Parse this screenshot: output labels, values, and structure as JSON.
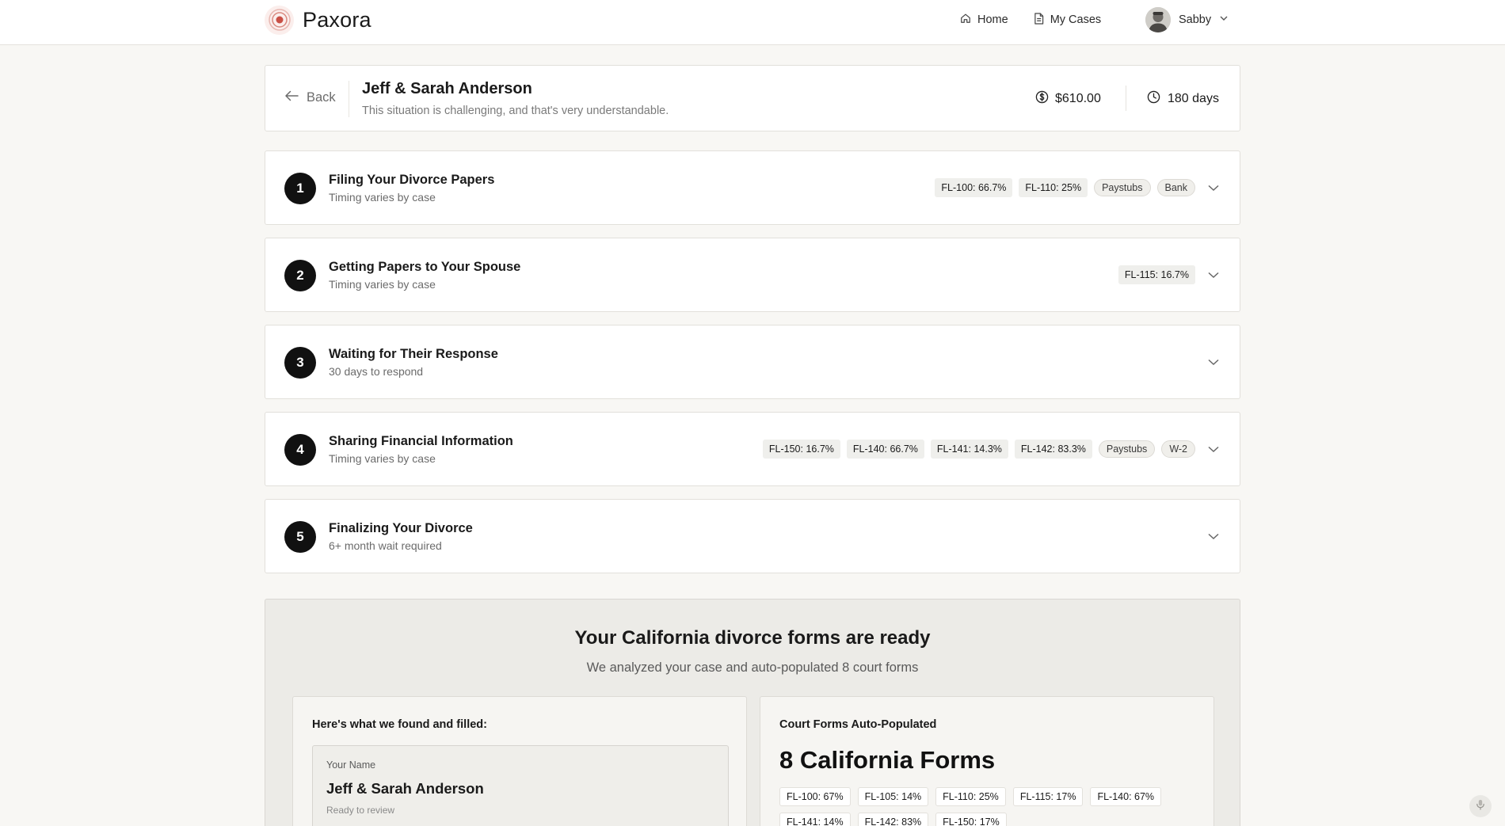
{
  "app": {
    "brand_name": "Paxora",
    "accent_color": "#c94f45"
  },
  "nav": {
    "home_label": "Home",
    "my_cases_label": "My Cases",
    "user_name": "Sabby"
  },
  "case": {
    "back_label": "Back",
    "title": "Jeff & Sarah Anderson",
    "subtitle": "This situation is challenging, and that's very understandable.",
    "fee": "$610.00",
    "timeline": "180 days"
  },
  "steps": [
    {
      "number": "1",
      "title": "Filing Your Divorce Papers",
      "subtitle": "Timing varies by case",
      "form_tags": [
        "FL-100: 66.7%",
        "FL-110: 25%"
      ],
      "doc_tags": [
        "Paystubs",
        "Bank"
      ]
    },
    {
      "number": "2",
      "title": "Getting Papers to Your Spouse",
      "subtitle": "Timing varies by case",
      "form_tags": [
        "FL-115: 16.7%"
      ],
      "doc_tags": []
    },
    {
      "number": "3",
      "title": "Waiting for Their Response",
      "subtitle": "30 days to respond",
      "form_tags": [],
      "doc_tags": []
    },
    {
      "number": "4",
      "title": "Sharing Financial Information",
      "subtitle": "Timing varies by case",
      "form_tags": [
        "FL-150: 16.7%",
        "FL-140: 66.7%",
        "FL-141: 14.3%",
        "FL-142: 83.3%"
      ],
      "doc_tags": [
        "Paystubs",
        "W-2"
      ]
    },
    {
      "number": "5",
      "title": "Finalizing Your Divorce",
      "subtitle": "6+ month wait required",
      "form_tags": [],
      "doc_tags": []
    }
  ],
  "forms_panel": {
    "title": "Your California divorce forms are ready",
    "subtitle": "We analyzed your case and auto-populated 8 court forms",
    "found": {
      "heading": "Here's what we found and filled:",
      "field_label": "Your Name",
      "field_value": "Jeff & Sarah Anderson",
      "field_status": "Ready to review"
    },
    "court": {
      "heading": "Court Forms Auto-Populated",
      "count_label": "8 California Forms",
      "forms": [
        "FL-100: 67%",
        "FL-105: 14%",
        "FL-110: 25%",
        "FL-115: 17%",
        "FL-140: 67%",
        "FL-141: 14%",
        "FL-142: 83%",
        "FL-150: 17%"
      ]
    }
  },
  "icons": {
    "logo": "target-logo-icon",
    "home": "home-icon",
    "cases": "document-icon",
    "back": "arrow-left-icon",
    "fee": "dollar-circle-icon",
    "timeline": "clock-icon",
    "expand": "chevron-down-icon",
    "mic": "microphone-icon"
  }
}
